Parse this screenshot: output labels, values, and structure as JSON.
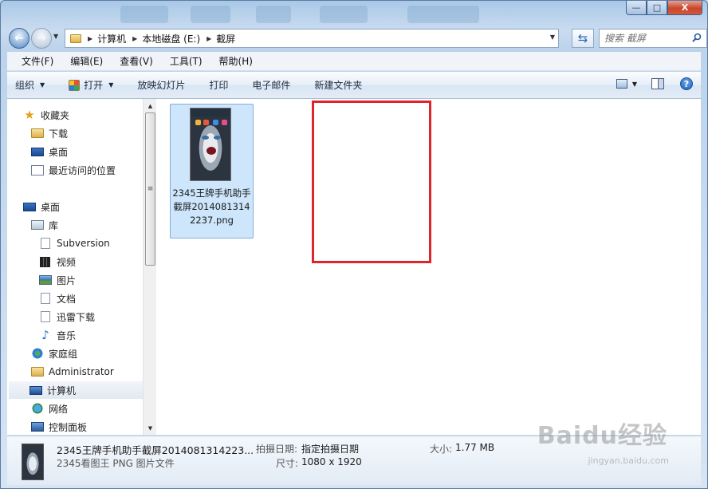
{
  "window": {
    "caption_buttons": {
      "minimize": "—",
      "maximize": "□",
      "close": "X"
    }
  },
  "address_bar": {
    "crumbs": [
      "计算机",
      "本地磁盘 (E:)",
      "截屏"
    ]
  },
  "search": {
    "placeholder": "搜索 截屏"
  },
  "menu": [
    "文件(F)",
    "编辑(E)",
    "查看(V)",
    "工具(T)",
    "帮助(H)"
  ],
  "toolbar": {
    "organize": "组织",
    "open": "打开",
    "slideshow": "放映幻灯片",
    "print": "打印",
    "email": "电子邮件",
    "new_folder": "新建文件夹"
  },
  "sidebar": {
    "favorites": [
      "收藏夹",
      "下载",
      "桌面",
      "最近访问的位置"
    ],
    "tree": [
      "桌面",
      "库",
      "Subversion",
      "视频",
      "图片",
      "文档",
      "迅雷下载",
      "音乐",
      "家庭组",
      "Administrator",
      "计算机",
      "网络",
      "控制面板"
    ]
  },
  "file": {
    "name": "2345王牌手机助手截屏20140813142237.png"
  },
  "details": {
    "name": "2345王牌手机助手截屏2014081314223...",
    "type": "2345看图王 PNG 图片文件",
    "date_label": "拍摄日期:",
    "date_value": "指定拍摄日期",
    "size_label": "大小:",
    "size_value": "1.77 MB",
    "dim_label": "尺寸:",
    "dim_value": "1080 x 1920"
  },
  "watermark": {
    "brand": "Baidu经验",
    "url": "jingyan.baidu.com"
  },
  "colors": {
    "highlight": "#e0242c",
    "selection": "#cde6fb"
  }
}
